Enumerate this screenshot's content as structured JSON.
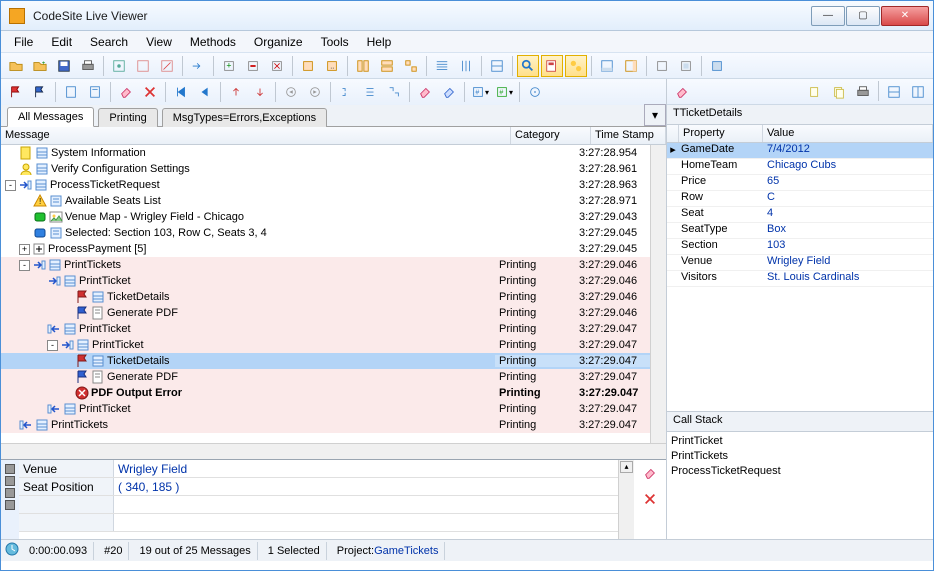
{
  "window": {
    "title": "CodeSite Live Viewer"
  },
  "menu": [
    "File",
    "Edit",
    "Search",
    "View",
    "Methods",
    "Organize",
    "Tools",
    "Help"
  ],
  "tabs": [
    {
      "label": "All Messages",
      "active": true
    },
    {
      "label": "Printing",
      "active": false
    },
    {
      "label": "MsgTypes=Errors,Exceptions",
      "active": false
    }
  ],
  "columns": {
    "message": "Message",
    "category": "Category",
    "timestamp": "Time Stamp"
  },
  "messages": [
    {
      "indent": 1,
      "icons": [
        "doc-yellow",
        "props"
      ],
      "text": "System Information",
      "cat": "",
      "time": "3:27:28.954"
    },
    {
      "indent": 1,
      "icons": [
        "user-yellow",
        "props"
      ],
      "text": "Verify Configuration Settings",
      "cat": "",
      "time": "3:27:28.961"
    },
    {
      "indent": 0,
      "icons": [
        "enter-arrow",
        "props"
      ],
      "text": "ProcessTicketRequest",
      "cat": "",
      "time": "3:27:28.963",
      "exp": "-"
    },
    {
      "indent": 2,
      "icons": [
        "warn",
        "list"
      ],
      "text": "Available Seats List",
      "cat": "",
      "time": "3:27:28.971"
    },
    {
      "indent": 2,
      "icons": [
        "green-led",
        "img"
      ],
      "text": "Venue Map - Wrigley Field - Chicago",
      "cat": "",
      "time": "3:27:29.043"
    },
    {
      "indent": 2,
      "icons": [
        "blue-led",
        "list"
      ],
      "text": "Selected: Section 103, Row C, Seats 3, 4",
      "cat": "",
      "time": "3:27:29.045"
    },
    {
      "indent": 1,
      "icons": [
        "plusbox"
      ],
      "text": "ProcessPayment  [5]",
      "cat": "",
      "time": "3:27:29.045",
      "exp": "+"
    },
    {
      "indent": 1,
      "icons": [
        "enter-arrow",
        "props"
      ],
      "text": "PrintTickets",
      "cat": "Printing",
      "time": "3:27:29.046",
      "exp": "-",
      "alt": true
    },
    {
      "indent": 3,
      "icons": [
        "enter-arrow",
        "props"
      ],
      "text": "PrintTicket",
      "cat": "Printing",
      "time": "3:27:29.046",
      "alt": true
    },
    {
      "indent": 5,
      "icons": [
        "flag-red",
        "props"
      ],
      "text": "TicketDetails",
      "cat": "Printing",
      "time": "3:27:29.046",
      "alt": true
    },
    {
      "indent": 5,
      "icons": [
        "flag-blue",
        "doc"
      ],
      "text": "Generate PDF",
      "cat": "Printing",
      "time": "3:27:29.046",
      "alt": true
    },
    {
      "indent": 3,
      "icons": [
        "exit-arrow",
        "props"
      ],
      "text": "PrintTicket",
      "cat": "Printing",
      "time": "3:27:29.047",
      "alt": true
    },
    {
      "indent": 3,
      "icons": [
        "enter-arrow",
        "props"
      ],
      "text": "PrintTicket",
      "cat": "Printing",
      "time": "3:27:29.047",
      "alt": true,
      "exp": "-"
    },
    {
      "indent": 5,
      "icons": [
        "flag-red",
        "props"
      ],
      "text": "TicketDetails",
      "cat": "Printing",
      "time": "3:27:29.047",
      "sel": true
    },
    {
      "indent": 5,
      "icons": [
        "flag-blue",
        "doc"
      ],
      "text": "Generate PDF",
      "cat": "Printing",
      "time": "3:27:29.047",
      "alt": true
    },
    {
      "indent": 5,
      "icons": [
        "error"
      ],
      "text": "PDF Output Error",
      "cat": "Printing",
      "time": "3:27:29.047",
      "alt": true,
      "bold": true
    },
    {
      "indent": 3,
      "icons": [
        "exit-arrow",
        "props"
      ],
      "text": "PrintTicket",
      "cat": "Printing",
      "time": "3:27:29.047",
      "alt": true
    },
    {
      "indent": 1,
      "icons": [
        "exit-arrow",
        "props"
      ],
      "text": "PrintTickets",
      "cat": "Printing",
      "time": "3:27:29.047",
      "alt": true
    }
  ],
  "bottomProps": [
    {
      "label": "Venue",
      "value": "Wrigley Field"
    },
    {
      "label": "Seat Position",
      "value": "( 340, 185 )"
    }
  ],
  "inspector": {
    "title": "TTicketDetails",
    "propHeader": "Property",
    "valHeader": "Value",
    "rows": [
      {
        "prop": "GameDate",
        "val": "7/4/2012",
        "sel": true
      },
      {
        "prop": "HomeTeam",
        "val": "Chicago Cubs"
      },
      {
        "prop": "Price",
        "val": "65"
      },
      {
        "prop": "Row",
        "val": "C"
      },
      {
        "prop": "Seat",
        "val": "4"
      },
      {
        "prop": "SeatType",
        "val": "Box"
      },
      {
        "prop": "Section",
        "val": "103"
      },
      {
        "prop": "Venue",
        "val": "Wrigley Field"
      },
      {
        "prop": "Visitors",
        "val": "St. Louis Cardinals"
      }
    ]
  },
  "callstack": {
    "title": "Call Stack",
    "items": [
      "PrintTicket",
      "PrintTickets",
      "ProcessTicketRequest"
    ]
  },
  "status": {
    "elapsed": "0:00:00.093",
    "count": "#20",
    "filter": "19 out of 25 Messages",
    "selected": "1 Selected",
    "projectLabel": "Project: ",
    "project": "GameTickets"
  }
}
